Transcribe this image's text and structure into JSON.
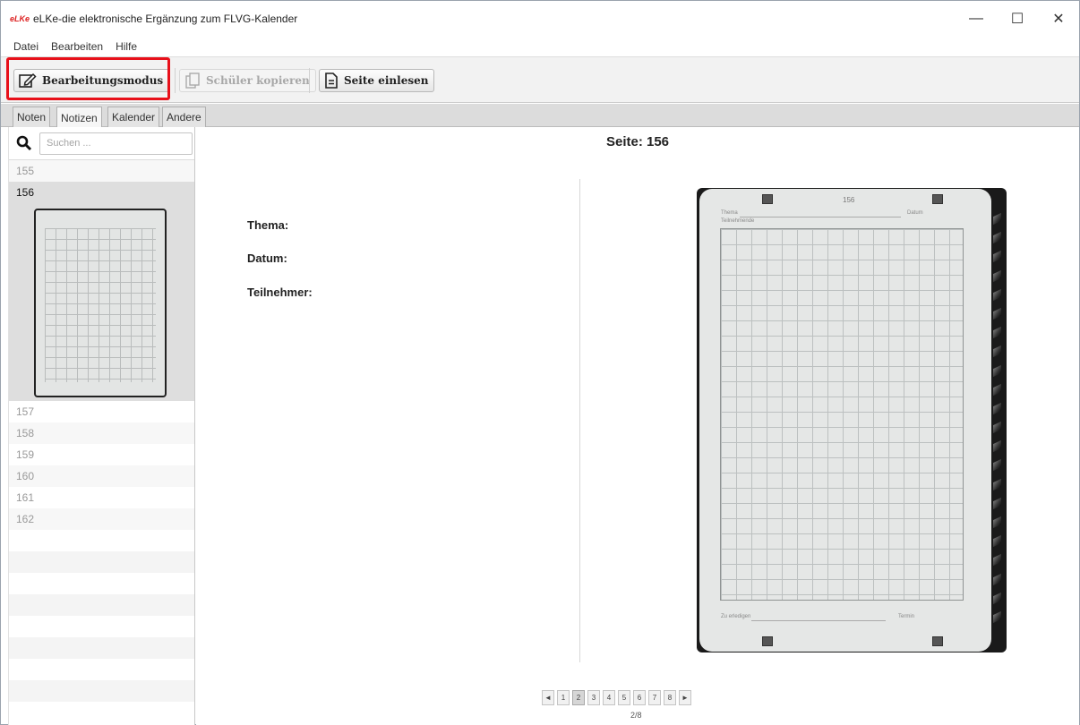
{
  "window": {
    "logo_text": "eLKe",
    "title": "eLKe-die elektronische Ergänzung zum FLVG-Kalender",
    "controls": {
      "minimize": "—",
      "maximize": "☐",
      "close": "✕"
    }
  },
  "menu": [
    "Datei",
    "Bearbeiten",
    "Hilfe"
  ],
  "toolbar": {
    "edit_mode_label": "Bearbeitungsmodus",
    "copy_students_label": "Schüler kopieren",
    "read_page_label": "Seite einlesen"
  },
  "tabs": [
    "Noten",
    "Notizen",
    "Kalender",
    "Andere"
  ],
  "active_tab": "Notizen",
  "sidebar": {
    "search_placeholder": "Suchen ...",
    "pages": [
      "155",
      "156",
      "157",
      "158",
      "159",
      "160",
      "161",
      "162"
    ],
    "selected_page": "156"
  },
  "main": {
    "heading": "Seite: 156",
    "fields": {
      "topic_label": "Thema:",
      "date_label": "Datum:",
      "participants_label": "Teilnehmer:"
    },
    "scan": {
      "page_number": "156",
      "topic": "Thema",
      "date": "Datum",
      "participants": "Teilnehmende",
      "footer_left": "Zu erledigen",
      "footer_right": "Termin"
    }
  },
  "pagination": {
    "prev": "◄",
    "pages": [
      "1",
      "2",
      "3",
      "4",
      "5",
      "6",
      "7",
      "8"
    ],
    "current": "2",
    "next": "►",
    "count_text": "2/8"
  },
  "colors": {
    "highlight": "#e8101a",
    "logo": "#dd2222"
  }
}
